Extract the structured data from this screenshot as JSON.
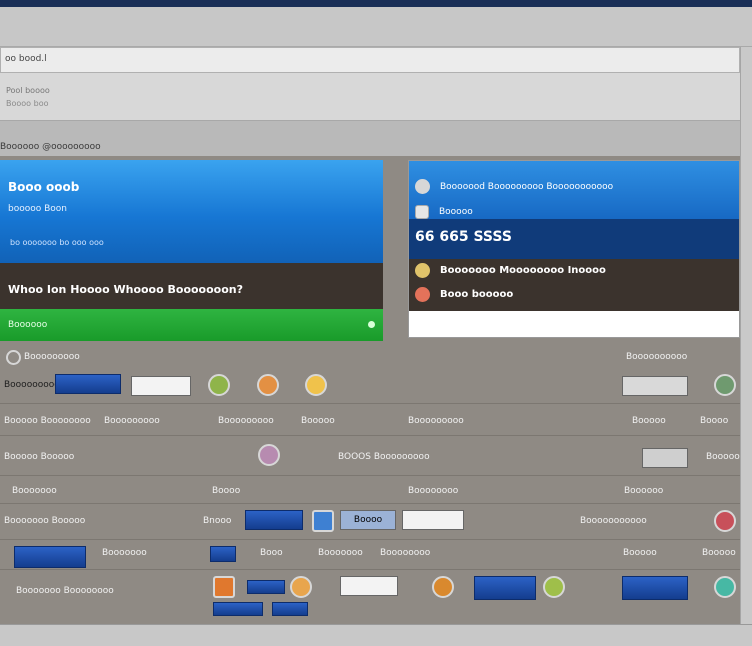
{
  "address": {
    "value": "oo bood.l"
  },
  "toolband": {
    "line1": "Pool boooo",
    "line2": "Boooo boo"
  },
  "section_label": "Boooooo @ooooooooo",
  "hero": {
    "title": "Booo ooob",
    "subtitle": "booooo Boon",
    "small": "bo ooooooo bo ooo ooo",
    "question": "Whoo Ion Hoooo Whoooo Booooooon?",
    "green_button": "Boooooo"
  },
  "info_panel": {
    "row1": "Booooood Booooooooo Booooooooooo",
    "row2": "Booooo",
    "row3": "66 665 SSSS",
    "row4": "Booooooo Moooooooo Inoooo",
    "row5": "Booo booooo"
  },
  "grid": {
    "row1": {
      "left": "Booooooooo",
      "right": "Boooooooooo",
      "mid": "Booooooooo"
    },
    "row2": {
      "left": "Booooo Boooooooo",
      "c2": "Booooooooo",
      "c3": "Booooooooo",
      "c4": "Booooo",
      "c5": "Booooooooo",
      "c6": "Booooo",
      "c7": "Boooo"
    },
    "row3": {
      "left": "Booooo Booooo",
      "mid": "BOOOS Booooooooo",
      "right": "Booooo"
    },
    "row4": {
      "c1": "Booooooo",
      "c2": "Boooo",
      "c3": "Boooooooo",
      "c4": "Boooooo"
    },
    "row5": {
      "left": "Booooooo Booooo",
      "c2": "Bnooo",
      "btn": "Boooo",
      "right": "Booooooooooo"
    },
    "row6": {
      "c1": "Booooooo",
      "c2": "Booo",
      "c3": "Booooooo",
      "c4": "Boooooooo",
      "c5": "Booooo",
      "c6": "Booooo"
    },
    "row7": {
      "left": "Booooooo Boooooooo"
    }
  }
}
